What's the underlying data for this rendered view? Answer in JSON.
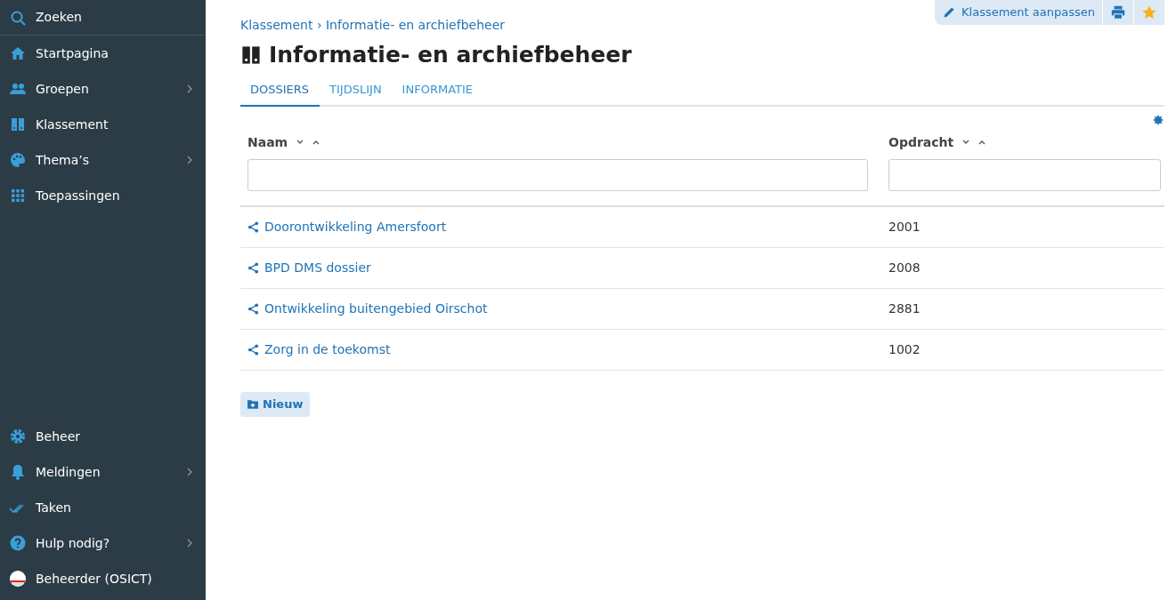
{
  "sidebar": {
    "top_items": [
      {
        "label": "Zoeken",
        "submenu": false
      },
      {
        "label": "Startpagina",
        "submenu": false
      },
      {
        "label": "Groepen",
        "submenu": true
      },
      {
        "label": "Klassement",
        "submenu": false
      },
      {
        "label": "Thema’s",
        "submenu": true
      },
      {
        "label": "Toepassingen",
        "submenu": false
      }
    ],
    "bottom_items": [
      {
        "label": "Beheer",
        "submenu": false
      },
      {
        "label": "Meldingen",
        "submenu": true
      },
      {
        "label": "Taken",
        "submenu": false
      },
      {
        "label": "Hulp nodig?",
        "submenu": true
      },
      {
        "label": "Beheerder (OSICT)",
        "submenu": false
      }
    ]
  },
  "toolbar": {
    "edit_label": "Klassement aanpassen"
  },
  "breadcrumb": [
    "Klassement",
    "Informatie- en archiefbeheer"
  ],
  "breadcrumb_separator": "›",
  "title": "Informatie- en archiefbeheer",
  "tabs": [
    {
      "label": "DOSSIERS",
      "selected": true
    },
    {
      "label": "TIJDSLIJN",
      "selected": false
    },
    {
      "label": "INFORMATIE",
      "selected": false
    }
  ],
  "table": {
    "columns": [
      "Naam",
      "Opdracht"
    ],
    "rows": [
      {
        "name": "Doorontwikkeling Amersfoort",
        "opdracht": "2001"
      },
      {
        "name": "BPD DMS dossier",
        "opdracht": "2008"
      },
      {
        "name": "Ontwikkeling buitengebied Oirschot",
        "opdracht": "2881"
      },
      {
        "name": "Zorg in de toekomst",
        "opdracht": "1002"
      }
    ]
  },
  "new_button": "Nieuw"
}
